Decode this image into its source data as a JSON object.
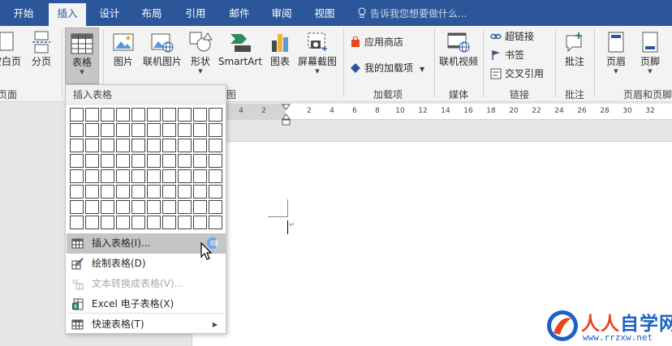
{
  "tabs": [
    "开始",
    "插入",
    "设计",
    "布局",
    "引用",
    "邮件",
    "审阅",
    "视图"
  ],
  "active_tab": "插入",
  "tell_me": "告诉我您想要做什么...",
  "ribbon": {
    "pages": {
      "blank_page": "空白页",
      "page_break": "分页",
      "group": "页面"
    },
    "tables": {
      "table": "表格"
    },
    "illustrations": {
      "picture": "图片",
      "online_picture": "联机图片",
      "shapes": "形状",
      "smartart": "SmartArt",
      "chart": "图表",
      "screenshot": "屏幕截图",
      "group_tail": "图"
    },
    "addins": {
      "store": "应用商店",
      "my_addins": "我的加载项",
      "group": "加载项"
    },
    "media": {
      "online_video": "联机视频",
      "group": "媒体"
    },
    "links": {
      "hyperlink": "超链接",
      "bookmark": "书签",
      "cross_reference": "交叉引用",
      "group": "链接"
    },
    "comments": {
      "comment": "批注",
      "group": "批注"
    },
    "header_footer": {
      "header": "页眉",
      "footer": "页脚",
      "group": "页眉和页脚"
    }
  },
  "ruler_ticks": [
    "4",
    "2",
    "2",
    "4",
    "6",
    "8",
    "10",
    "12",
    "14",
    "16",
    "18",
    "20",
    "22",
    "24",
    "26",
    "28",
    "30",
    "32"
  ],
  "dropdown": {
    "header": "插入表格",
    "grid": {
      "cols": 10,
      "rows": 8
    },
    "items": [
      {
        "label": "插入表格(I)...",
        "state": "hover"
      },
      {
        "label": "绘制表格(D)",
        "state": "normal"
      },
      {
        "label": "文本转换成表格(V)...",
        "state": "disabled"
      },
      {
        "label": "Excel 电子表格(X)",
        "state": "normal"
      },
      {
        "label": "快速表格(T)",
        "state": "normal",
        "submenu": true
      }
    ]
  },
  "watermark": {
    "title_red": "人人",
    "title_blue": "自学网",
    "url": "www.rrzxw.net"
  },
  "colors": {
    "tab_bar": "#2b579a",
    "ribbon": "#f3f3f3",
    "hover": "#c5c5c5",
    "watermark_red": "#e8461d",
    "watermark_blue": "#1a62c4"
  }
}
